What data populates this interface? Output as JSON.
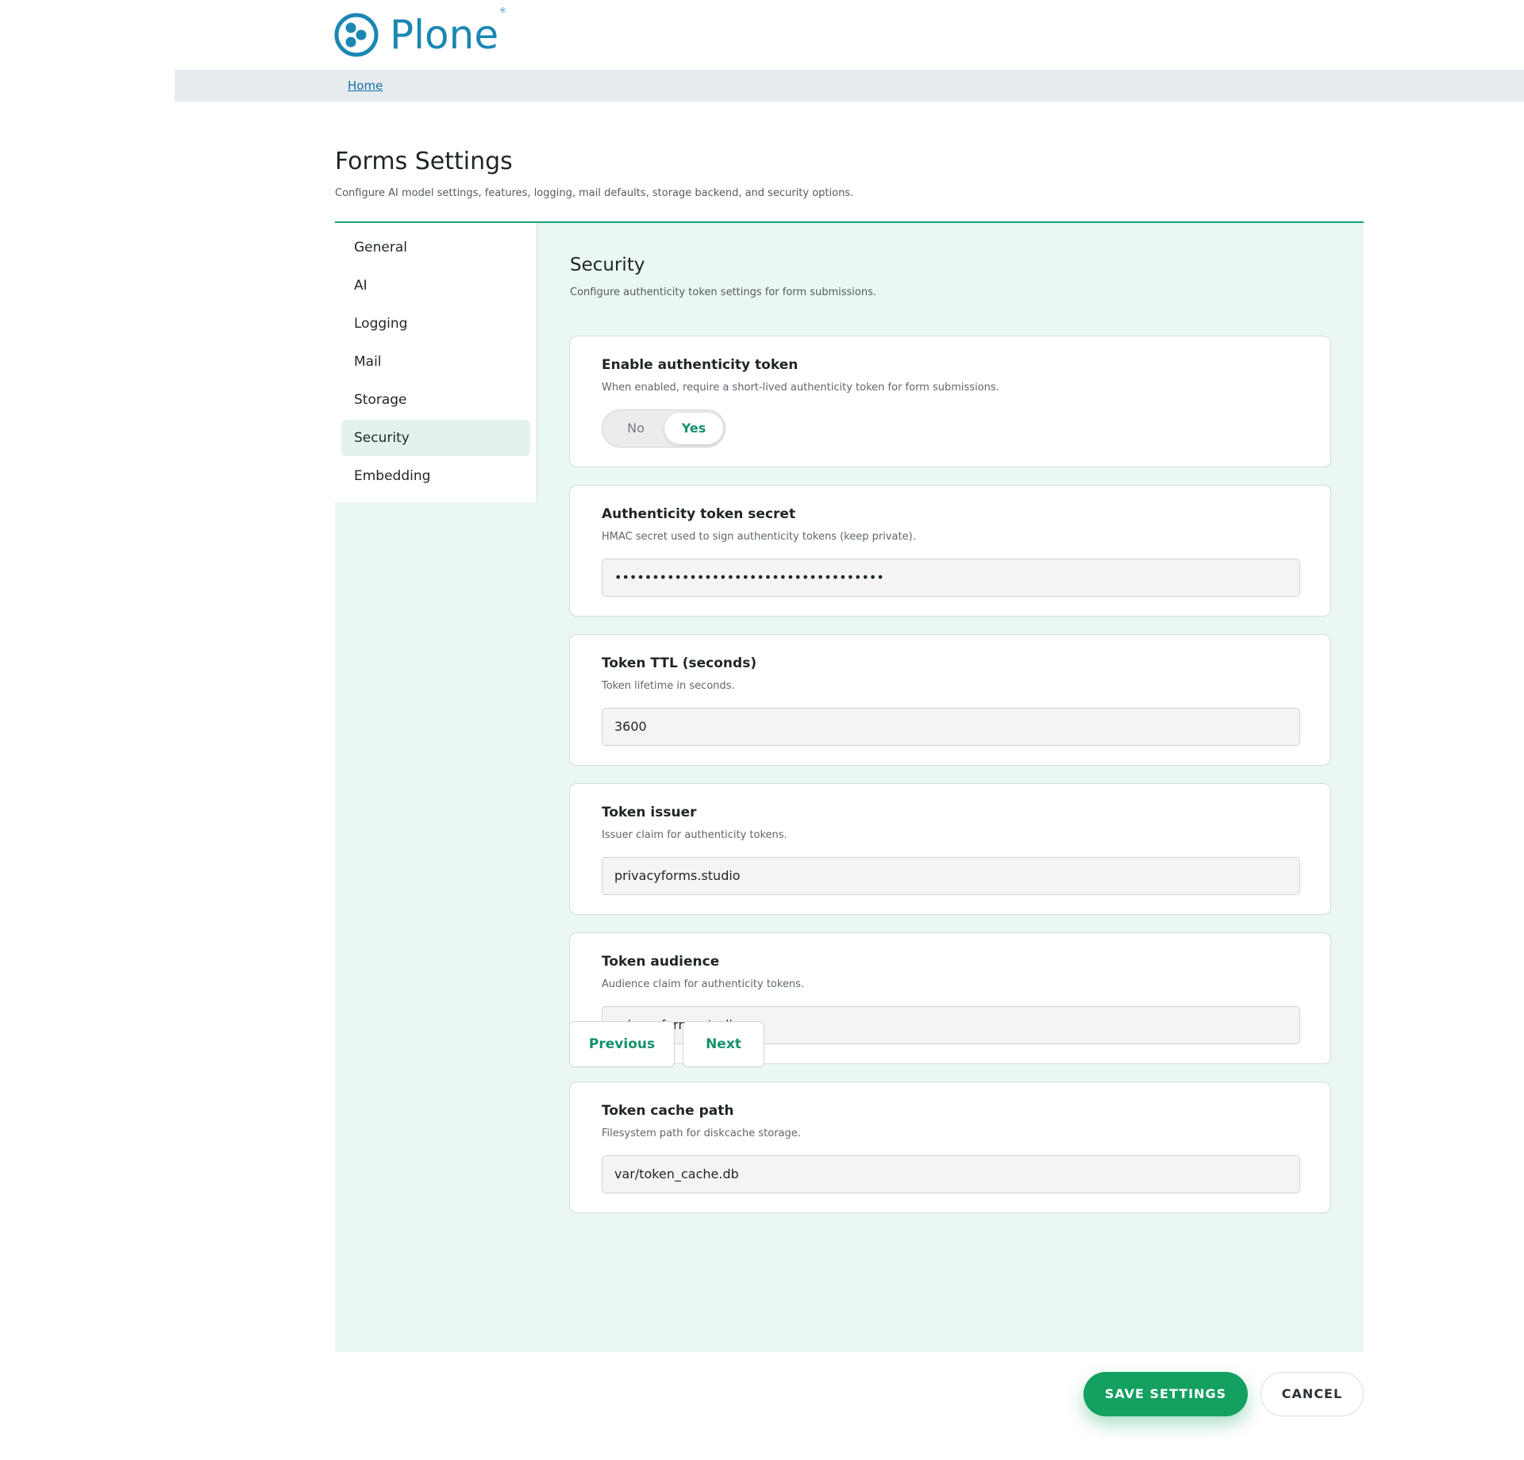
{
  "brand": {
    "name": "Plone",
    "reg_mark": "®",
    "color": "#1b87b3"
  },
  "breadcrumb": {
    "home": "Home"
  },
  "page": {
    "title": "Forms Settings",
    "description": "Configure AI model settings, features, logging, mail defaults, storage backend, and security options."
  },
  "sidebar": {
    "items": [
      {
        "label": "General"
      },
      {
        "label": "AI"
      },
      {
        "label": "Logging"
      },
      {
        "label": "Mail"
      },
      {
        "label": "Storage"
      },
      {
        "label": "Security",
        "active": true
      },
      {
        "label": "Embedding"
      }
    ]
  },
  "section": {
    "title": "Security",
    "description": "Configure authenticity token settings for form submissions."
  },
  "fields": {
    "enable_token": {
      "label": "Enable authenticity token",
      "help": "When enabled, require a short-lived authenticity token for form submissions.",
      "option_no": "No",
      "option_yes": "Yes",
      "selected": "Yes"
    },
    "token_secret": {
      "label": "Authenticity token secret",
      "help": "HMAC secret used to sign authenticity tokens (keep private).",
      "value": "••••••••••••••••••••••••••••••••••••"
    },
    "token_ttl": {
      "label": "Token TTL (seconds)",
      "help": "Token lifetime in seconds.",
      "value": "3600"
    },
    "token_issuer": {
      "label": "Token issuer",
      "help": "Issuer claim for authenticity tokens.",
      "value": "privacyforms.studio"
    },
    "token_audience": {
      "label": "Token audience",
      "help": "Audience claim for authenticity tokens.",
      "value": "privacyforms.studio"
    },
    "token_cache_path": {
      "label": "Token cache path",
      "help": "Filesystem path for diskcache storage.",
      "value": "var/token_cache.db"
    }
  },
  "navigation": {
    "previous": "Previous",
    "next": "Next"
  },
  "actions": {
    "save": "SAVE SETTINGS",
    "cancel": "CANCEL"
  },
  "colors": {
    "accent": "#13a060",
    "panel_bg": "#ebf7f3",
    "link": "#0f6fa8"
  }
}
